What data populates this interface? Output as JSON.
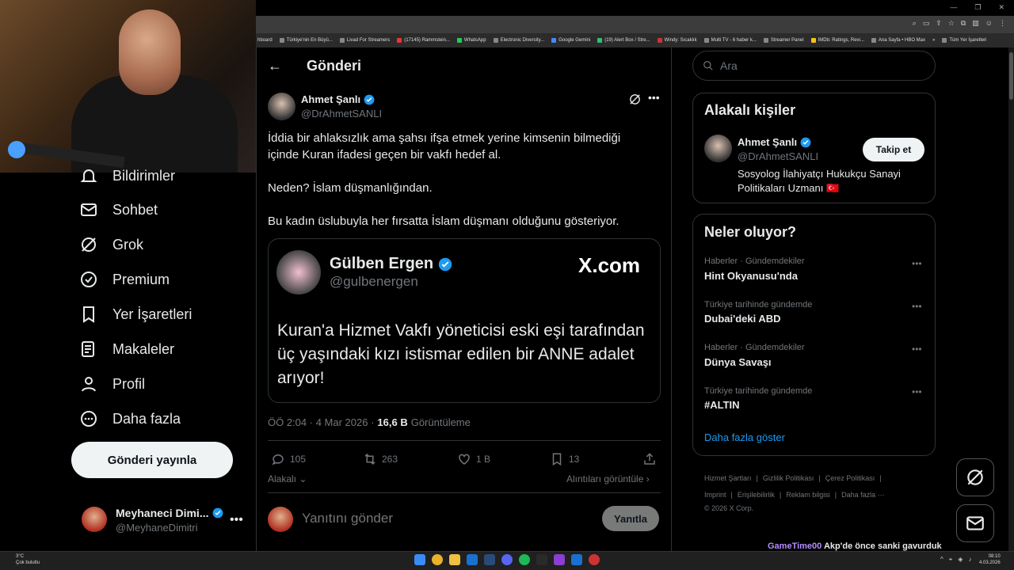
{
  "browser": {
    "bookmarks": [
      "hboard",
      "Türkiye'nin En Büyü...",
      "Livad For Streamers",
      "(17145) Rammstein...",
      "WhatsApp",
      "Electronic Diversity...",
      "Google Gemini",
      "(19) Alert Box / Stre...",
      "Windy: Sıcaklık",
      "Multi TV - 6 haber k...",
      "Streamer Panel",
      "IMDb: Ratings, Revi...",
      "Ana Sayfa • HBO Max",
      "Tüm Yer İşaretleri"
    ],
    "overflow": "»"
  },
  "nav": {
    "items": [
      {
        "label": "Bildirimler",
        "icon": "bell-icon"
      },
      {
        "label": "Sohbet",
        "icon": "mail-icon"
      },
      {
        "label": "Grok",
        "icon": "grok-icon"
      },
      {
        "label": "Premium",
        "icon": "premium-icon"
      },
      {
        "label": "Yer İşaretleri",
        "icon": "bookmark-icon"
      },
      {
        "label": "Makaleler",
        "icon": "article-icon"
      },
      {
        "label": "Profil",
        "icon": "profile-icon"
      },
      {
        "label": "Daha fazla",
        "icon": "more-circle-icon"
      }
    ],
    "post_button": "Gönderi yayınla",
    "me": {
      "name": "Meyhaneci Dimi...",
      "handle": "@MeyhaneDimitri"
    }
  },
  "header": {
    "title": "Gönderi"
  },
  "post": {
    "author": "Ahmet Şanlı",
    "handle": "@DrAhmetSANLI",
    "paragraphs": [
      "İddia bir ahlaksızlık ama şahsı ifşa etmek yerine kimsenin bilmediği içinde Kuran ifadesi geçen bir vakfı hedef al.",
      "Neden? İslam düşmanlığından.",
      "Bu kadın üslubuyla her fırsatta İslam düşmanı olduğunu gösteriyor."
    ],
    "quote": {
      "author": "Gülben Ergen",
      "handle": "@gulbenergen",
      "source": "X.com",
      "text": "Kuran'a Hizmet Vakfı yöneticisi eski eşi tarafından üç yaşındaki kızı istismar edilen bir ANNE adalet arıyor!"
    },
    "time": "ÖÖ 2:04 · 4 Mar 2026 ·",
    "views": "16,6 B",
    "views_label": "Görüntüleme",
    "replies": "105",
    "reposts": "263",
    "likes": "1 B",
    "bookmarks": "13",
    "relevant": "Alakalı",
    "view_quotes": "Alıntıları görüntüle",
    "reply_placeholder": "Yanıtını gönder",
    "reply_button": "Yanıtla"
  },
  "sidebar": {
    "search_placeholder": "Ara",
    "related_title": "Alakalı kişiler",
    "related": {
      "name": "Ahmet Şanlı",
      "handle": "@DrAhmetSANLI",
      "bio": "Sosyolog İlahiyatçı Hukukçu Sanayi Politikaları Uzmanı 🇹🇷",
      "follow": "Takip et"
    },
    "trends_title": "Neler oluyor?",
    "trends": [
      {
        "context": "Haberler · Gündemdekiler",
        "name": "Hint Okyanusu'nda"
      },
      {
        "context": "Türkiye tarihinde gündemde",
        "name": "Dubai'deki ABD"
      },
      {
        "context": "Haberler · Gündemdekiler",
        "name": "Dünya Savaşı"
      },
      {
        "context": "Türkiye tarihinde gündemde",
        "name": "#ALTIN"
      }
    ],
    "show_more": "Daha fazla göster",
    "footer": [
      "Hizmet Şartları",
      "|",
      "Gizlilik Politikası",
      "|",
      "Çerez Politikası",
      "|",
      "Imprint",
      "|",
      "Erişilebilirlik",
      "|",
      "Reklam bilgisi",
      "|",
      "Daha fazla ···",
      "© 2026 X Corp."
    ]
  },
  "chat": {
    "user": "GameTime00",
    "message": "Akp'de önce sanki gavurduk müslümanlığı bunlar getirdi"
  },
  "taskbar": {
    "temp": "3°C",
    "weather": "Çok bulutlu",
    "time": "08:10",
    "date": "4.03.2026"
  },
  "colors": {
    "accent": "#1d9bf0",
    "bg": "#000000",
    "border": "#2f3336",
    "muted": "#71767b"
  }
}
